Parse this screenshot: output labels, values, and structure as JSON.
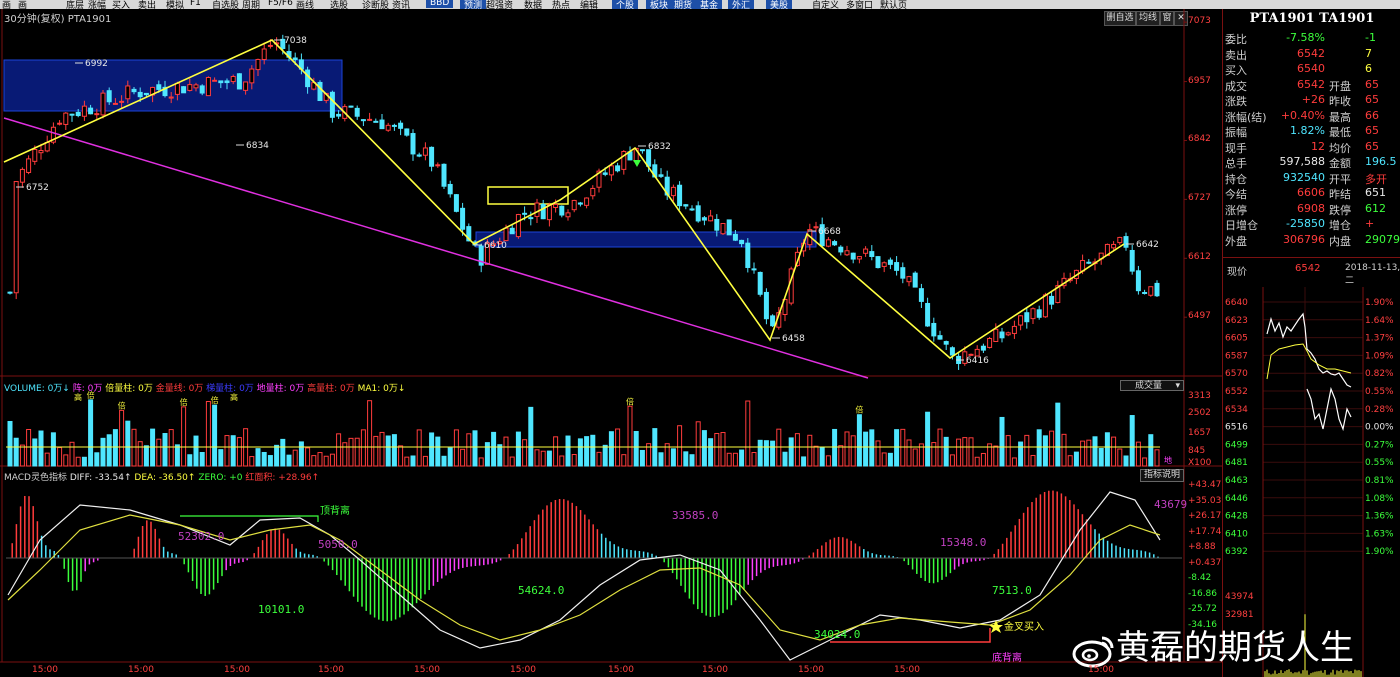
{
  "toolbar": {
    "items": [
      "画",
      "画",
      "底层",
      "涨幅",
      "买入",
      "卖出",
      "模拟",
      "F1",
      "自选股",
      "周期",
      "F5/F6",
      "画线",
      "选股",
      "诊断股",
      "资讯",
      "BBD",
      "预测",
      "超强资",
      "数据",
      "热点",
      "编辑",
      "个股",
      "板块",
      "期货",
      "基金",
      "外汇",
      "美股",
      "自定义",
      "多窗口",
      "默认页"
    ]
  },
  "chart": {
    "title": "30分钟(复权)  PTA1901",
    "buttons": [
      "删自选",
      "均线",
      "窗",
      "✕"
    ]
  },
  "price_axis": [
    "7073",
    "6957",
    "6842",
    "6727",
    "6612",
    "6497"
  ],
  "price_labels": {
    "p7038": "7038",
    "p6992": "6992",
    "p6834": "6834",
    "p6752": "6752",
    "p6832": "6832",
    "p6610": "6610",
    "p6668": "6668",
    "p6458": "6458",
    "p6416": "6416",
    "p6642": "6642"
  },
  "volume": {
    "legend": [
      {
        "text": "VOLUME: 0万↓",
        "color": "#4fe6ff"
      },
      {
        "text": "阵: 0万",
        "color": "#ff40ff"
      },
      {
        "text": "倍量柱: 0万",
        "color": "#ffff40"
      },
      {
        "text": "金量线: 0万",
        "color": "#ff3c3c"
      },
      {
        "text": "梯量柱: 0万",
        "color": "#3c3cff"
      },
      {
        "text": "地量柱: 0万",
        "color": "#ff40ff"
      },
      {
        "text": "高量柱: 0万",
        "color": "#ff3c3c"
      },
      {
        "text": "MA1: 0万↓",
        "color": "#ffff40"
      }
    ],
    "dropdown": "成交量",
    "axis": [
      "3313",
      "2502",
      "1657",
      "845",
      "X100"
    ],
    "tag": "高",
    "tag2": "倍",
    "corner": "地"
  },
  "macd": {
    "legend": [
      {
        "text": "MACD灵色指标",
        "color": "#d0d0d0"
      },
      {
        "text": "DIFF: -33.54↑",
        "color": "#e8e8e8"
      },
      {
        "text": "DEA: -36.50↑",
        "color": "#ffff40"
      },
      {
        "text": "ZERO: +0",
        "color": "#3cff3c"
      },
      {
        "text": "红面积: +28.96↑",
        "color": "#ff3c3c"
      }
    ],
    "help_button": "指标说明",
    "axis": [
      "+43.47",
      "+35.03",
      "+26.17",
      "+17.74",
      "+8.88",
      "+0.437",
      "-8.42",
      "-16.86",
      "-25.72",
      "-34.16"
    ],
    "areas": {
      "a1": "52302.0",
      "a2": "10101.0",
      "a3": "5050.0",
      "a4": "54624.0",
      "a5": "33585.0",
      "a6": "34024.0",
      "a7": "15348.0",
      "a8": "7513.0",
      "a9": "43679"
    },
    "annotations": {
      "top_div": "顶背离",
      "bottom_div": "底背离",
      "golden": "金叉买入"
    }
  },
  "time_axis": [
    "15:00",
    "15:00",
    "15:00",
    "15:00",
    "15:00",
    "15:00",
    "15:00",
    "15:00",
    "15:00",
    "15:00",
    "15:00"
  ],
  "quote": {
    "title": "PTA1901 TA1901",
    "rows": [
      {
        "l": "委比",
        "v": "-7.58%",
        "vc": "green",
        "l2": "",
        "v2": "-1",
        "v2c": "green"
      },
      {
        "l": "卖出",
        "v": "6542",
        "vc": "red",
        "l2": "",
        "v2": "7",
        "v2c": "yellow"
      },
      {
        "l": "买入",
        "v": "6540",
        "vc": "red",
        "l2": "",
        "v2": "6",
        "v2c": "yellow"
      },
      {
        "l": "成交",
        "v": "6542",
        "vc": "red",
        "l2": "开盘",
        "v2": "65",
        "v2c": "red"
      },
      {
        "l": "涨跌",
        "v": "+26",
        "vc": "red",
        "l2": "昨收",
        "v2": "65",
        "v2c": "red"
      },
      {
        "l": "涨幅(结)",
        "v": "+0.40%",
        "vc": "red",
        "l2": "最高",
        "v2": "66",
        "v2c": "red"
      },
      {
        "l": "振幅",
        "v": "1.82%",
        "vc": "cyan",
        "l2": "最低",
        "v2": "65",
        "v2c": "red"
      },
      {
        "l": "现手",
        "v": "12",
        "vc": "red",
        "l2": "均价",
        "v2": "65",
        "v2c": "red"
      },
      {
        "l": "总手",
        "v": "597,588",
        "vc": "white",
        "l2": "金额",
        "v2": "196.5",
        "v2c": "cyan"
      },
      {
        "l": "持仓",
        "v": "932540",
        "vc": "cyan",
        "l2": "开平",
        "v2": "多开",
        "v2c": "red"
      },
      {
        "l": "今结",
        "v": "6606",
        "vc": "red",
        "l2": "昨结",
        "v2": "651",
        "v2c": "white"
      },
      {
        "l": "涨停",
        "v": "6908",
        "vc": "red",
        "l2": "跌停",
        "v2": "612",
        "v2c": "green"
      },
      {
        "l": "日增仓",
        "v": "-25850",
        "vc": "cyan",
        "l2": "增仓",
        "v2": "+",
        "v2c": "red"
      },
      {
        "l": "外盘",
        "v": "306796",
        "vc": "red",
        "l2": "内盘",
        "v2": "29079",
        "v2c": "green"
      }
    ],
    "now_label": "现价",
    "now_value": "6542",
    "date": "2018-11-13,二",
    "intraday_left": [
      "6640",
      "6623",
      "6605",
      "6587",
      "6570",
      "6552",
      "6534",
      "6516",
      "6499",
      "6481",
      "6463",
      "6446",
      "6428",
      "6410",
      "6392"
    ],
    "intraday_right": [
      "1.90%",
      "1.64%",
      "1.37%",
      "1.09%",
      "0.82%",
      "0.55%",
      "0.28%",
      "0.00%",
      "0.27%",
      "0.55%",
      "0.81%",
      "1.08%",
      "1.36%",
      "1.63%",
      "1.90%"
    ],
    "vol_left": [
      "43974",
      "32981"
    ]
  },
  "watermark": "黄磊的期货人生"
}
